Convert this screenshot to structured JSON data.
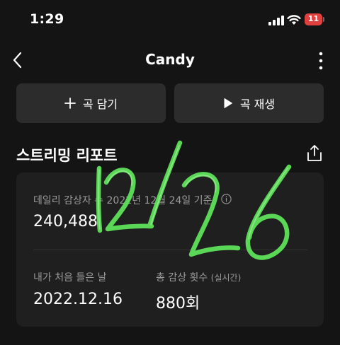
{
  "status_bar": {
    "time": "1:29",
    "battery": "11",
    "battery_color": "#e0413f",
    "icons": [
      "cellular-signal-icon",
      "wifi-icon",
      "battery-icon"
    ]
  },
  "nav": {
    "title": "Candy",
    "back_icon": "chevron-left-icon",
    "more_icon": "more-vertical-icon"
  },
  "actions": {
    "add_label": "곡 담기",
    "add_icon": "plus-icon",
    "play_label": "곡 재생",
    "play_icon": "play-icon"
  },
  "streaming": {
    "title": "스트리밍 리포트",
    "share_icon": "share-icon",
    "daily_label": "데일리 감상자 수 2022년 12월 24일 기준",
    "daily_value": "240,488",
    "first_listen_label": "내가 처음 들은 날",
    "first_listen_value": "2022.12.16",
    "total_plays_label": "총 감상 횟수",
    "total_plays_sub": "(실시간)",
    "total_plays_value": "880회"
  },
  "overlay": {
    "handwriting": "12/26",
    "color": "#5fe15a"
  },
  "colors": {
    "background": "#141414",
    "button": "#2c2c2c",
    "card": "#1f1f1f",
    "muted_text": "#9a9a9a"
  }
}
